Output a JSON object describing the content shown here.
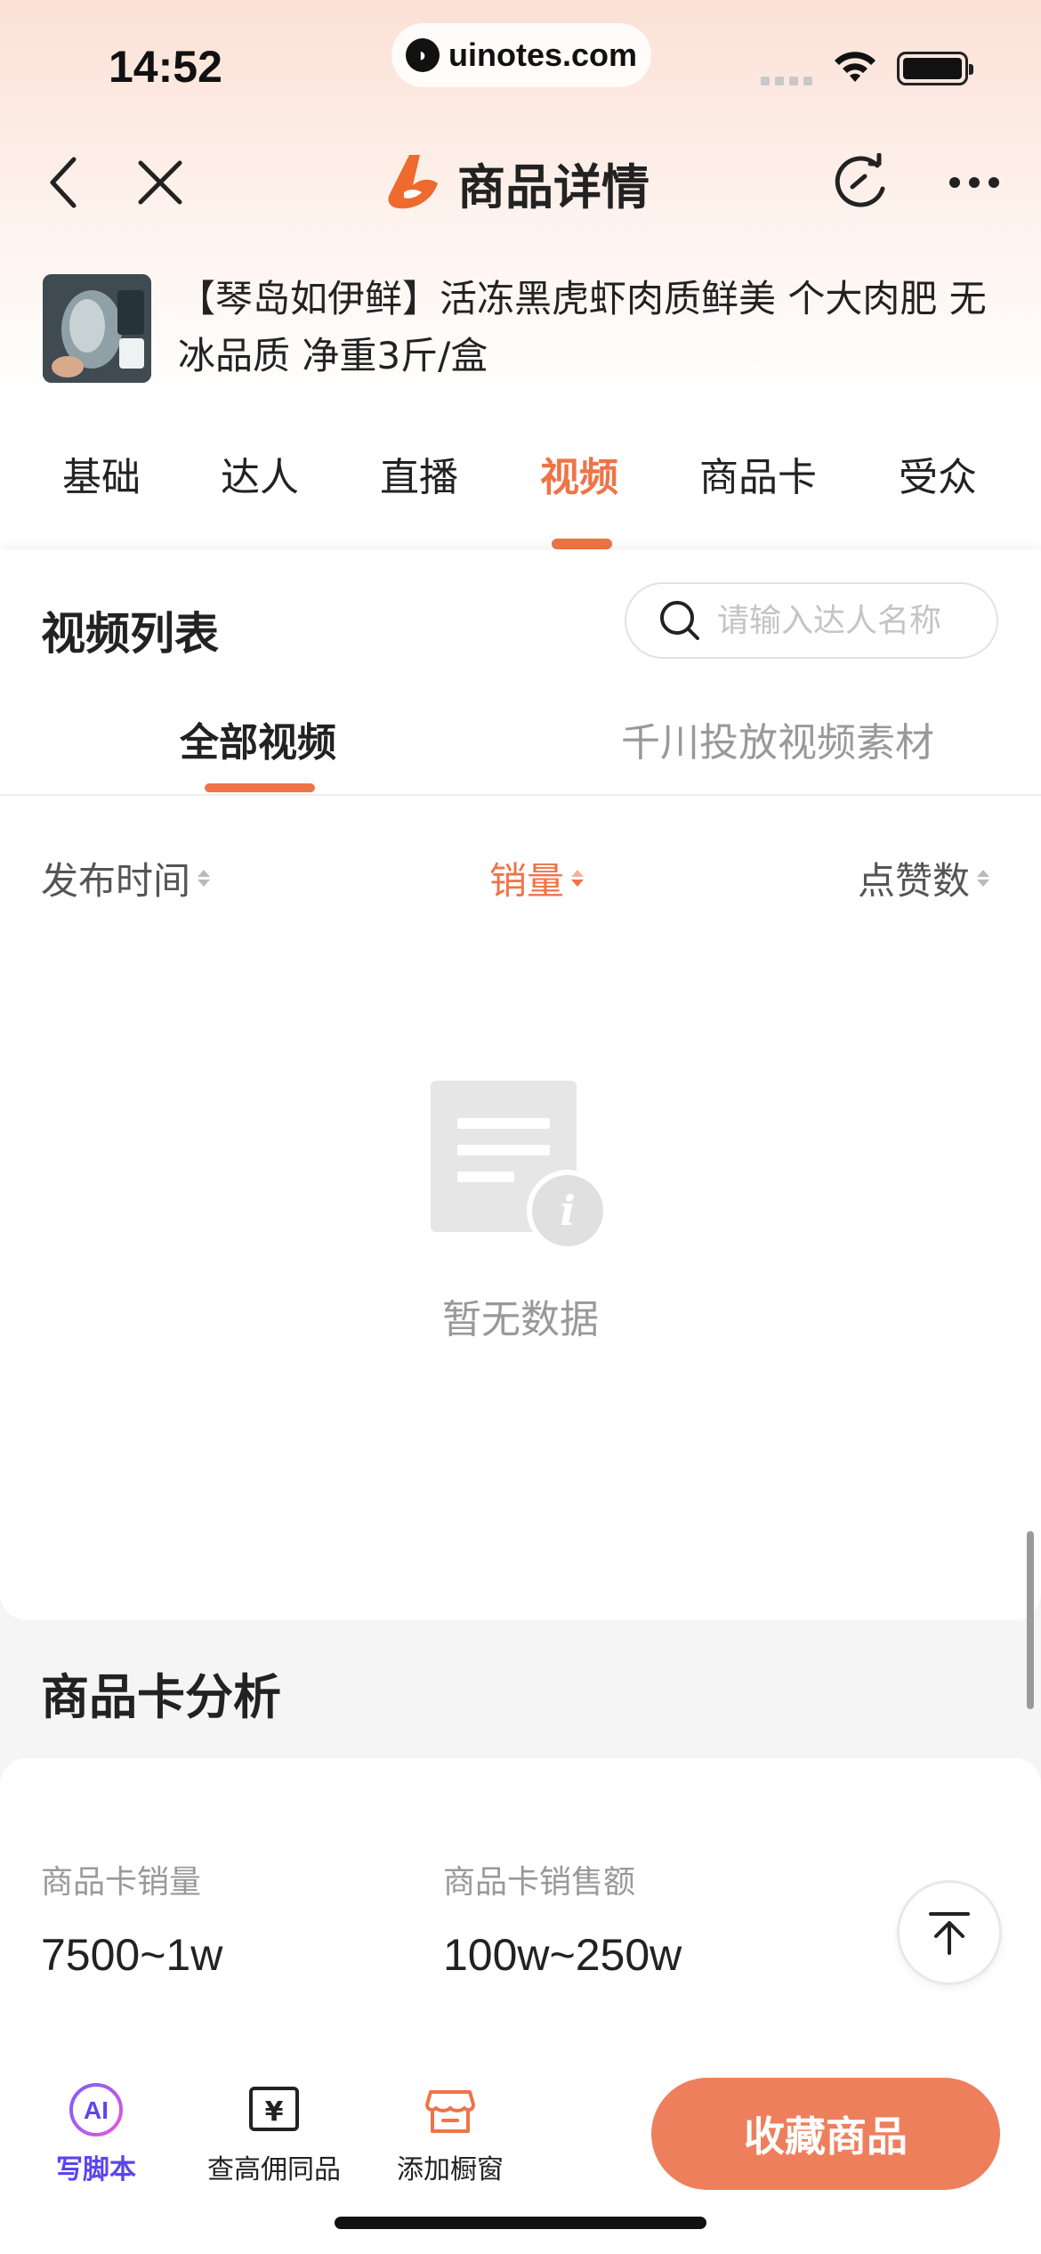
{
  "status_bar": {
    "time": "14:52",
    "url": "uinotes.com"
  },
  "nav": {
    "title": "商品详情",
    "back_icon": "chevron-left-icon",
    "close_icon": "close-icon",
    "refresh_icon": "refresh-icon",
    "more_icon": "more-icon"
  },
  "product": {
    "title": "【琴岛如伊鲜】活冻黑虎虾肉质鲜美 个大肉肥 无冰品质 净重3斤/盒"
  },
  "main_tabs": {
    "items": [
      {
        "label": "基础"
      },
      {
        "label": "达人"
      },
      {
        "label": "直播"
      },
      {
        "label": "视频"
      },
      {
        "label": "商品卡"
      },
      {
        "label": "受众"
      }
    ],
    "active": "视频"
  },
  "video_list": {
    "title": "视频列表",
    "search_placeholder": "请输入达人名称",
    "sub_tabs": [
      {
        "label": "全部视频"
      },
      {
        "label": "千川投放视频素材"
      }
    ],
    "active_sub_tab": "全部视频",
    "sort": [
      {
        "label": "发布时间"
      },
      {
        "label": "销量"
      },
      {
        "label": "点赞数"
      }
    ],
    "active_sort": "销量",
    "empty_text": "暂无数据"
  },
  "card_analysis": {
    "title": "商品卡分析",
    "stats": [
      {
        "label": "商品卡销量",
        "value": "7500~1w"
      },
      {
        "label": "商品卡销售额",
        "value": "100w~250w"
      }
    ]
  },
  "bottom_bar": {
    "items": [
      {
        "label": "写脚本",
        "icon": "ai-icon"
      },
      {
        "label": "查高佣同品",
        "icon": "yen-icon"
      },
      {
        "label": "添加橱窗",
        "icon": "store-icon"
      }
    ],
    "primary_button": "收藏商品"
  },
  "colors": {
    "accent": "#ee7448",
    "button": "#ee7f5c",
    "ai": "#5b45f0"
  }
}
